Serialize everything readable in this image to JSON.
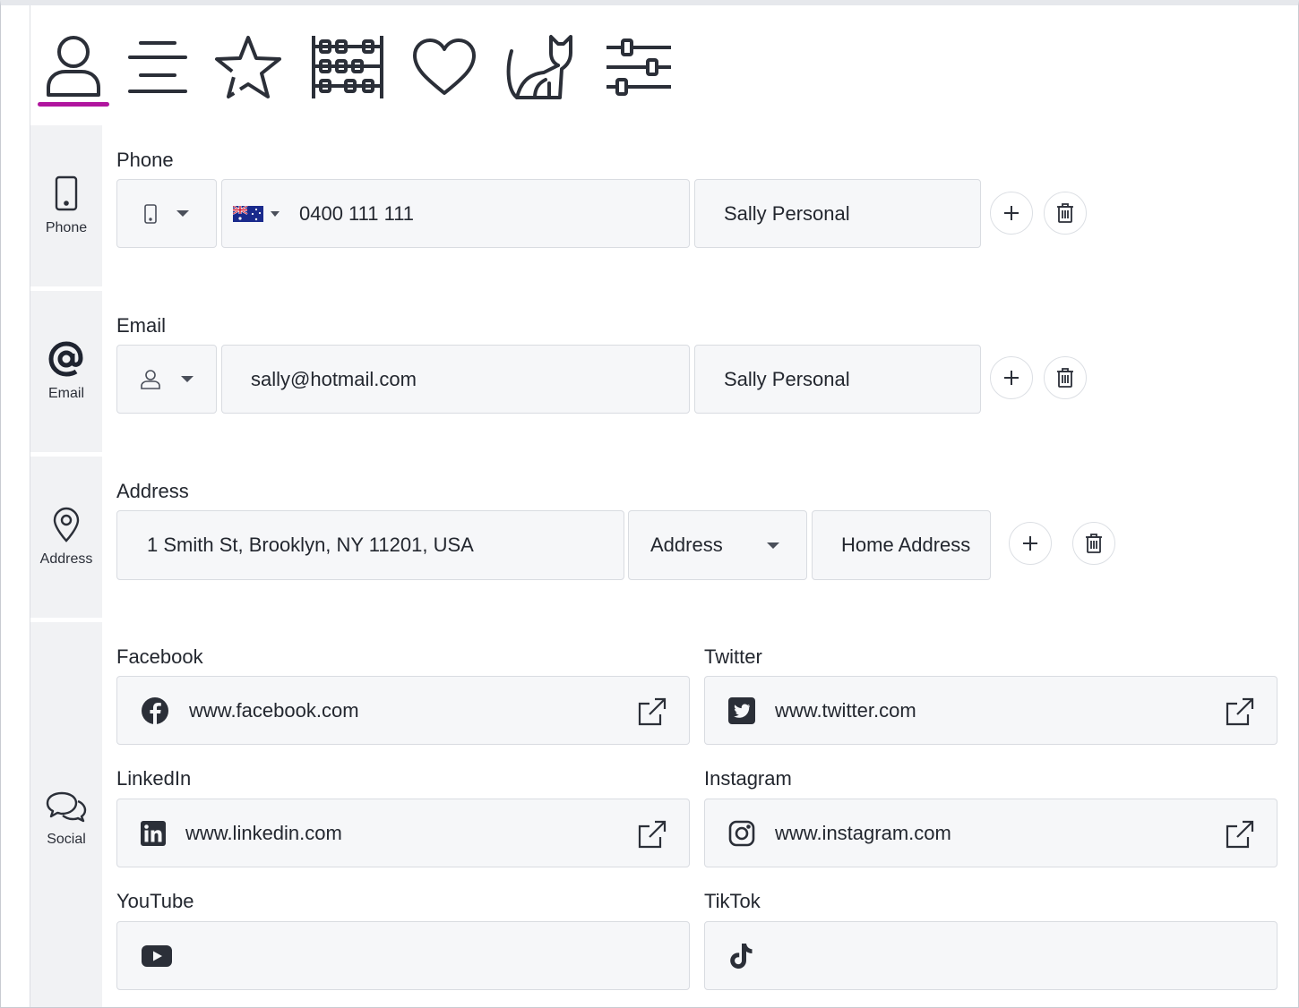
{
  "tabs": [
    {
      "icon": "user-icon",
      "active": true
    },
    {
      "icon": "lines-icon"
    },
    {
      "icon": "star-icon"
    },
    {
      "icon": "abacus-icon"
    },
    {
      "icon": "heart-icon"
    },
    {
      "icon": "cat-icon"
    },
    {
      "icon": "sliders-icon"
    }
  ],
  "sidenav": {
    "phone": "Phone",
    "email": "Email",
    "address": "Address",
    "social": "Social"
  },
  "phone": {
    "label": "Phone",
    "type_icon": "mobile-phone-icon",
    "country_flag": "australia-flag-icon",
    "number": "0400 111 111",
    "tag": "Sally Personal"
  },
  "email": {
    "label": "Email",
    "type_icon": "user-icon",
    "value": "sally@hotmail.com",
    "tag": "Sally Personal"
  },
  "address": {
    "label": "Address",
    "value": "1 Smith St, Brooklyn, NY 11201, USA",
    "type": "Address",
    "tag": "Home Address"
  },
  "social": {
    "facebook": {
      "label": "Facebook",
      "value": "www.facebook.com"
    },
    "twitter": {
      "label": "Twitter",
      "value": "www.twitter.com"
    },
    "linkedin": {
      "label": "LinkedIn",
      "value": "www.linkedin.com"
    },
    "instagram": {
      "label": "Instagram",
      "value": "www.instagram.com"
    },
    "youtube": {
      "label": "YouTube",
      "value": ""
    },
    "tiktok": {
      "label": "TikTok",
      "value": ""
    }
  },
  "colors": {
    "accent": "#b0159e",
    "sidebar_bg": "#f1f2f4",
    "field_bg": "#f6f7f9",
    "icon": "#2b2f38"
  }
}
